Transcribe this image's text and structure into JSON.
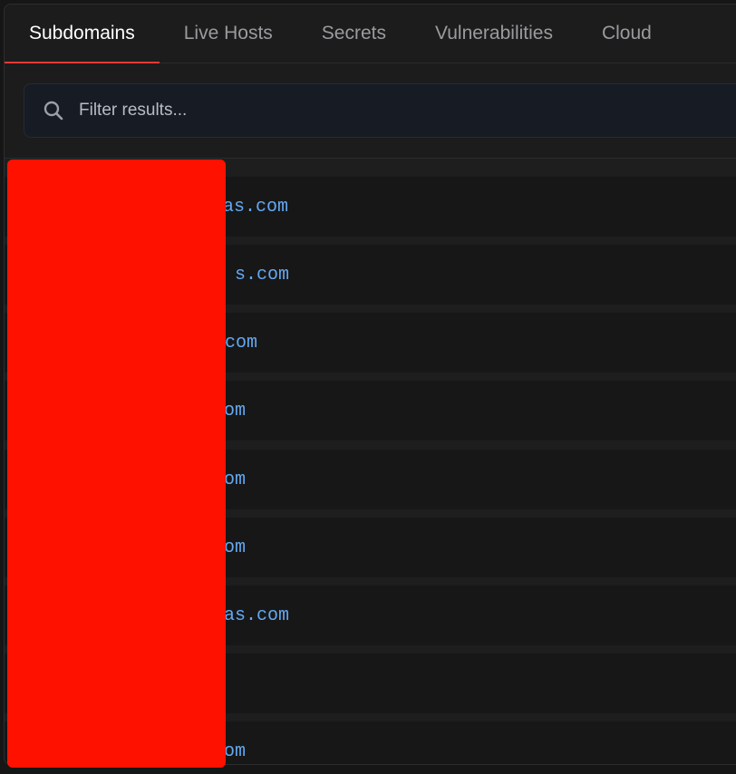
{
  "tabs": [
    {
      "label": "Subdomains",
      "active": true
    },
    {
      "label": "Live Hosts",
      "active": false
    },
    {
      "label": "Secrets",
      "active": false
    },
    {
      "label": "Vulnerabilities",
      "active": false
    },
    {
      "label": "Cloud",
      "active": false
    }
  ],
  "filter": {
    "placeholder": "Filter results...",
    "value": ""
  },
  "results": [
    {
      "domain_visible": "nas.com"
    },
    {
      "domain_visible": "s.com"
    },
    {
      "domain_visible": "com"
    },
    {
      "domain_visible": "om"
    },
    {
      "domain_visible": "om"
    },
    {
      "domain_visible": "om"
    },
    {
      "domain_visible": "as.com"
    },
    {
      "domain_visible": ""
    },
    {
      "domain_visible": "om"
    }
  ],
  "colors": {
    "accent": "#e53935",
    "link": "#64a8f0",
    "redaction": "#ff1100"
  }
}
